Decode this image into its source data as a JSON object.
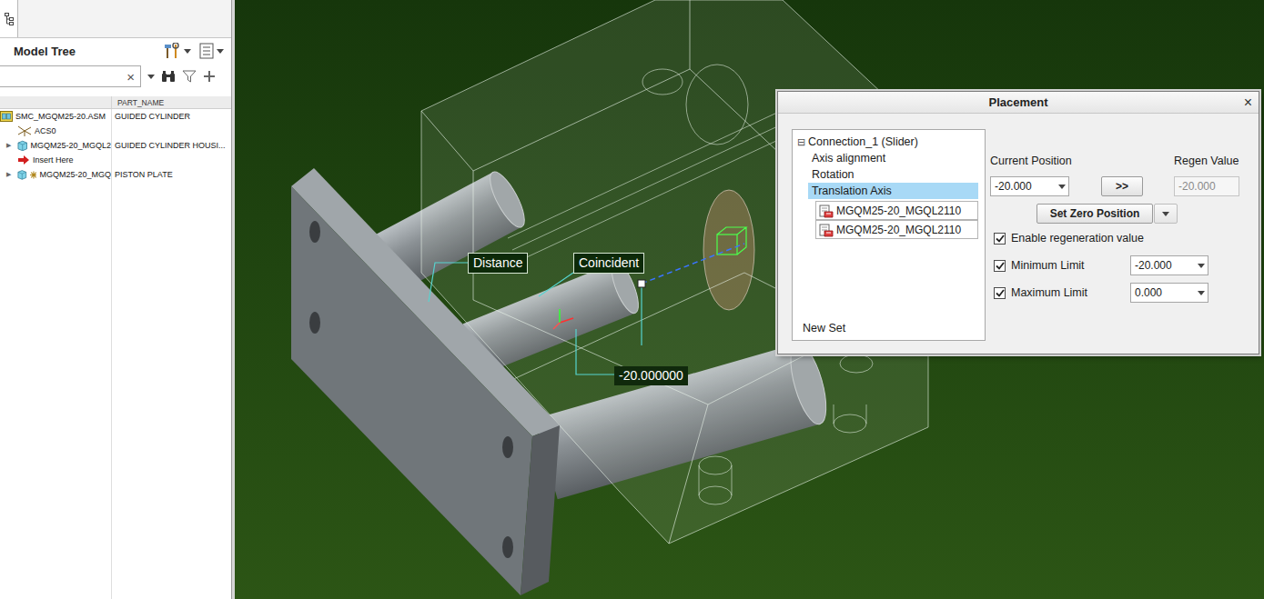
{
  "model_tree": {
    "title": "Model Tree",
    "search": {
      "value": "",
      "clear": "×"
    },
    "columns": [
      "PART_NAME"
    ],
    "expander": "▶",
    "rows": [
      {
        "name": "SMC_MGQM25-20.ASM",
        "part_name": "GUIDED CYLINDER",
        "kind": "assembly",
        "depth": 0,
        "expandable": false,
        "packaged": false
      },
      {
        "name": "ACS0",
        "part_name": "",
        "kind": "csys",
        "depth": 1,
        "expandable": false,
        "packaged": false
      },
      {
        "name": "MGQM25-20_MGQL2",
        "part_name": "GUIDED CYLINDER HOUSI...",
        "kind": "part",
        "depth": 1,
        "expandable": true,
        "packaged": false
      },
      {
        "name": "Insert Here",
        "part_name": "",
        "kind": "insert",
        "depth": 1,
        "expandable": false,
        "packaged": false
      },
      {
        "name": "MGQM25-20_MGQ",
        "part_name": "PISTON PLATE",
        "kind": "part",
        "depth": 1,
        "expandable": true,
        "packaged": true
      }
    ]
  },
  "viewport": {
    "annotations": [
      {
        "text": "Distance",
        "kind": "constraint"
      },
      {
        "text": "Coincident",
        "kind": "constraint"
      },
      {
        "text": "-20.000000",
        "kind": "dimension"
      }
    ]
  },
  "placement": {
    "title": "Placement",
    "close": "×",
    "tree": {
      "expander": "⊟",
      "label": "Connection_1 (Slider)",
      "expanded": true,
      "items": [
        {
          "label": "Axis alignment",
          "selected": false
        },
        {
          "label": "Rotation",
          "selected": false
        },
        {
          "label": "Translation Axis",
          "selected": true
        }
      ],
      "references": [
        "MGQM25-20_MGQL2110",
        "MGQM25-20_MGQL2110"
      ],
      "new_set": "New Set"
    },
    "current_position": {
      "label": "Current Position",
      "value": "-20.000"
    },
    "apply": ">>",
    "regen_value": {
      "label": "Regen Value",
      "value": "-20.000",
      "disabled": true
    },
    "set_zero": "Set Zero Position",
    "options": [
      {
        "label": "Enable regeneration value",
        "checked": true,
        "kind": "checkbox"
      },
      {
        "label": "Minimum Limit",
        "checked": true,
        "kind": "limit",
        "value": "-20.000"
      },
      {
        "label": "Maximum Limit",
        "checked": true,
        "kind": "limit",
        "value": "0.000"
      }
    ]
  }
}
